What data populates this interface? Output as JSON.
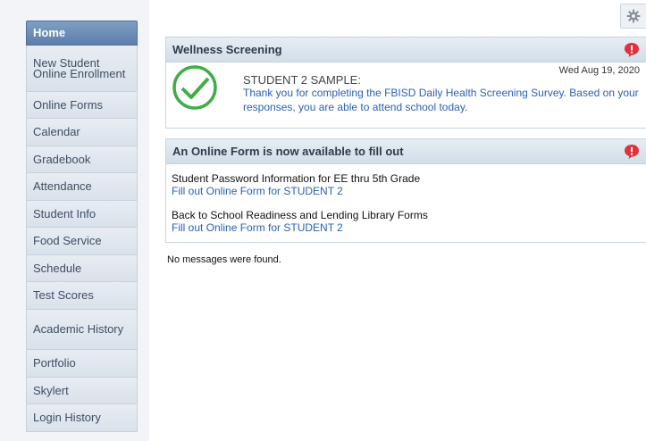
{
  "sidebar": {
    "items": [
      {
        "label": "Home",
        "active": true
      },
      {
        "label": "New Student Online Enrollment"
      },
      {
        "label": "Online Forms"
      },
      {
        "label": "Calendar"
      },
      {
        "label": "Gradebook"
      },
      {
        "label": "Attendance"
      },
      {
        "label": "Student Info"
      },
      {
        "label": "Food Service"
      },
      {
        "label": "Schedule"
      },
      {
        "label": "Test Scores"
      },
      {
        "label": "Academic History"
      },
      {
        "label": "Portfolio"
      },
      {
        "label": "Skylert"
      },
      {
        "label": "Login History"
      }
    ]
  },
  "wellness": {
    "title": "Wellness Screening",
    "date": "Wed Aug 19, 2020",
    "student": "STUDENT 2 SAMPLE:",
    "message": "Thank you for completing the FBISD Daily Health Screening Survey.  Based on your responses, you are able to attend school today."
  },
  "online_form": {
    "title": "An Online Form is now available to fill out",
    "forms": [
      {
        "name": "Student Password Information for EE thru 5th Grade",
        "link": "Fill out Online Form for STUDENT 2"
      },
      {
        "name": "Back to School Readiness and Lending Library Forms",
        "link": "Fill out Online Form for STUDENT 2"
      }
    ]
  },
  "messages": {
    "empty_text": "No messages were found."
  },
  "colors": {
    "accent": "#5c7ea9",
    "link": "#2a62b4",
    "check": "#3fae49",
    "alert": "#e0323a"
  },
  "icons": {
    "settings": "gear-icon",
    "alert": "alert-icon",
    "check": "checkmark-circle-icon"
  }
}
